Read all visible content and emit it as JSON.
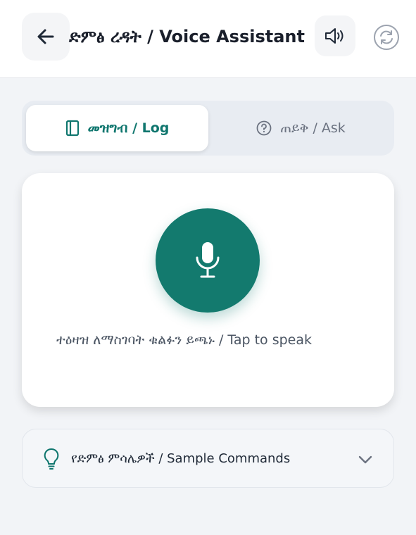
{
  "header": {
    "title": "ድምፅ ረዳት / Voice Assistant"
  },
  "icons": {
    "back": "arrow-left-icon",
    "speaker": "speaker-icon",
    "refresh": "refresh-icon",
    "log": "notebook-icon",
    "ask": "question-circle-icon",
    "mic": "microphone-icon",
    "bulb": "lightbulb-icon",
    "chevron": "chevron-down-icon"
  },
  "tabs": [
    {
      "label": "መዝግብ / Log",
      "active": true
    },
    {
      "label": "ጠይቅ / Ask",
      "active": false
    }
  ],
  "voice_card": {
    "prompt": "ተዕዛዝ ለማስገባት ቁልፉን ይጫኑ / Tap to speak"
  },
  "samples": {
    "label": "የድምፅ ምሳሌዎች / Sample Commands"
  },
  "colors": {
    "accent": "#137a6e",
    "background": "#f2f4f7"
  }
}
